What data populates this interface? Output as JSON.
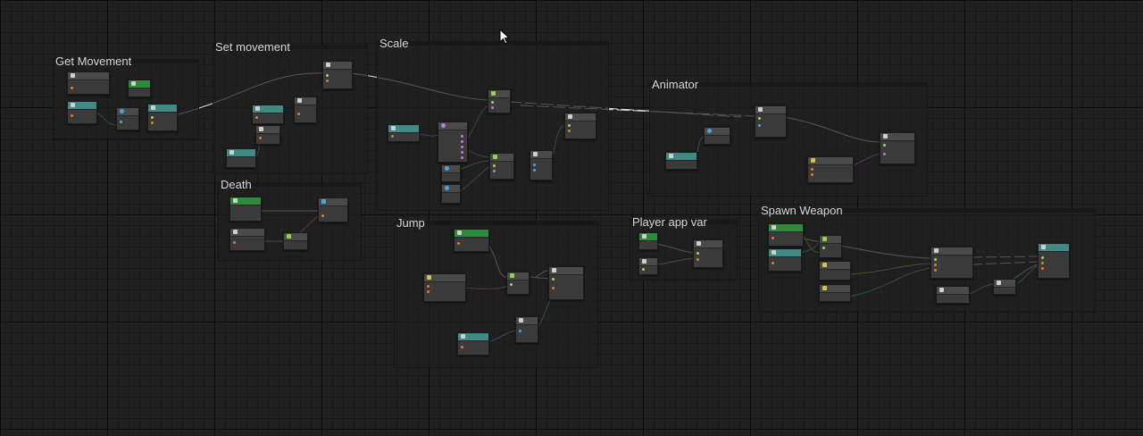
{
  "groups": [
    {
      "id": "get-movement",
      "title": "Get Movement"
    },
    {
      "id": "set-movement",
      "title": "Set movement"
    },
    {
      "id": "scale",
      "title": "Scale"
    },
    {
      "id": "animator",
      "title": "Animator"
    },
    {
      "id": "death",
      "title": "Death"
    },
    {
      "id": "jump",
      "title": "Jump"
    },
    {
      "id": "player-app-var",
      "title": "Player app var"
    },
    {
      "id": "spawn-weapon",
      "title": "Spawn Weapon"
    }
  ],
  "colors": {
    "background": "#202020",
    "node": "#3a3a3a",
    "header_green": "#2f8a3a",
    "header_teal": "#3f8a86",
    "wire_white": "#e6e6e6",
    "wire_teal": "#5fc7c0",
    "wire_orange": "#e07a30",
    "wire_purple": "#c07ad8",
    "wire_yellow": "#d8c24a",
    "wire_green": "#8ad84a"
  },
  "icons": {
    "cursor": "mouse-pointer-icon"
  }
}
